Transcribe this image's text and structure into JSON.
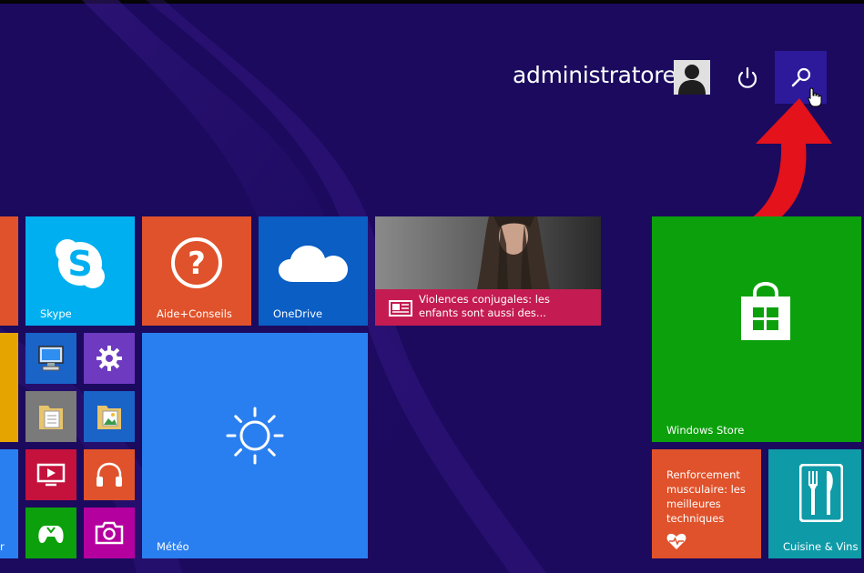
{
  "user": {
    "name": "administratore"
  },
  "header": {
    "power_icon": "power-icon",
    "search_icon": "search-icon"
  },
  "tiles": {
    "skype": {
      "label": "Skype",
      "color": "#00aff0"
    },
    "help": {
      "label": "Aide+Conseils",
      "color": "#e0522b"
    },
    "onedrive": {
      "label": "OneDrive",
      "color": "#0a5ec4"
    },
    "news": {
      "headline": "Violences conjugales: les enfants sont aussi des...",
      "color": "#c41c52"
    },
    "store": {
      "label": "Windows Store",
      "color": "#0ca10c"
    },
    "weather": {
      "label": "Météo",
      "color": "#2a7ff0"
    },
    "health": {
      "text": "Renforcement musculaire: les meilleures techniques",
      "color": "#e0522b"
    },
    "food": {
      "label": "Cuisine & Vins",
      "color": "#0f9aa8"
    },
    "partial_left_label": "r"
  },
  "colors": {
    "background": "#1b0a5e",
    "search_highlight": "#2c1a9a",
    "arrow": "#e3121b"
  }
}
